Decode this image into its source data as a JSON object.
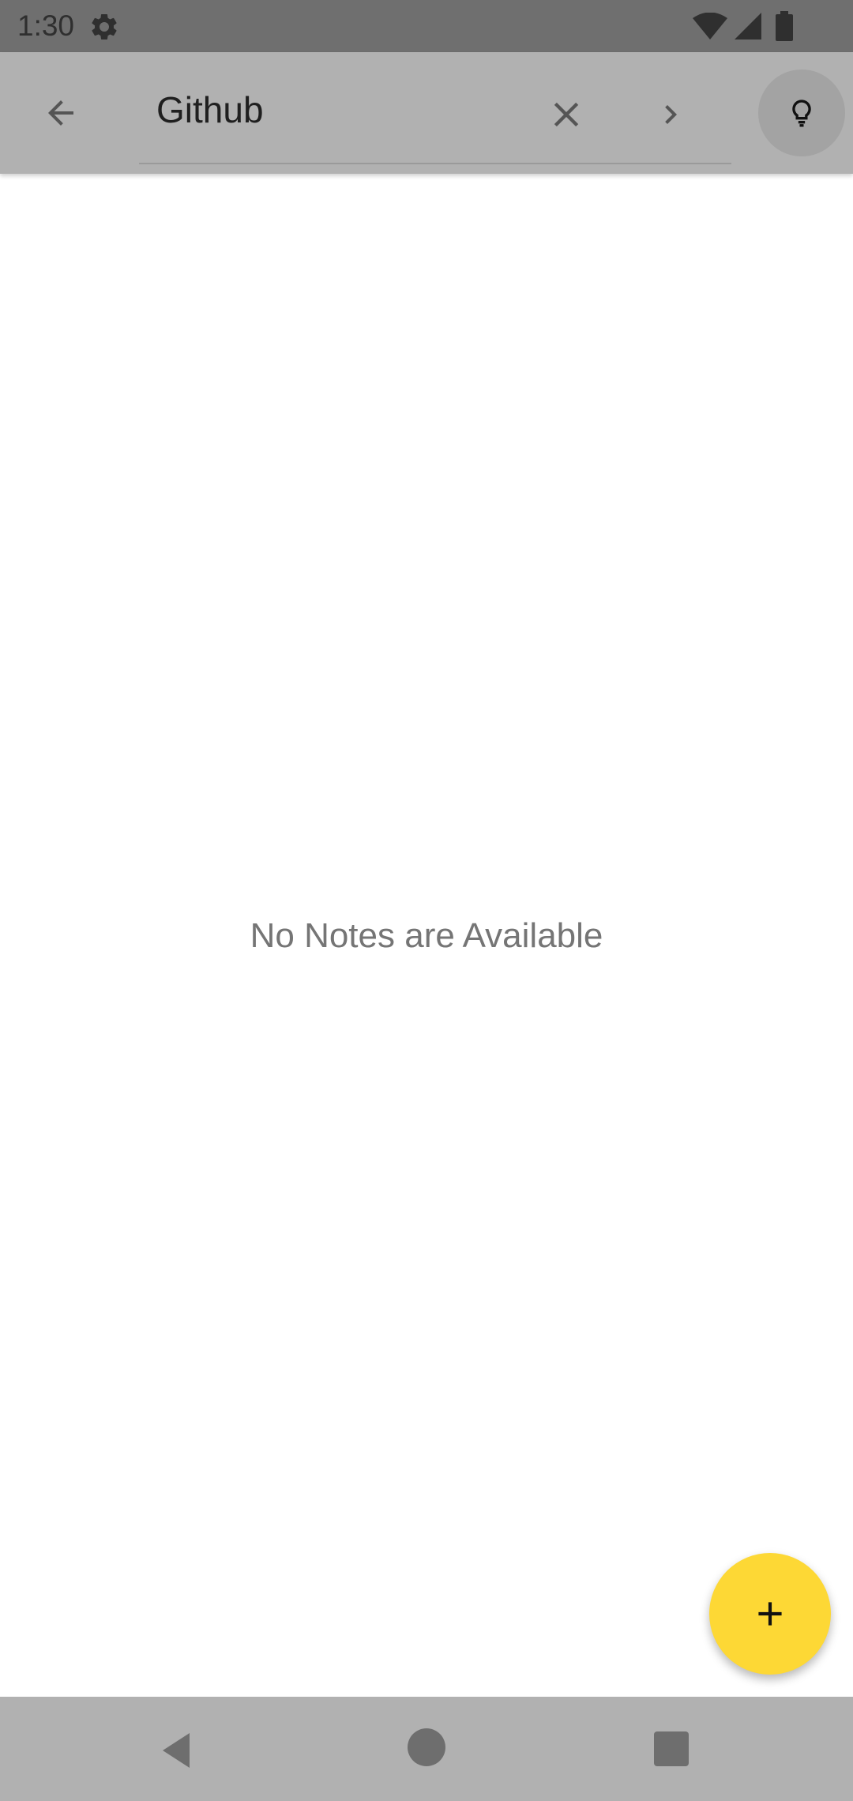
{
  "status_bar": {
    "time": "1:30",
    "icons": [
      "gear-icon",
      "wifi-icon",
      "cellular-signal-icon",
      "battery-icon"
    ]
  },
  "toolbar": {
    "search_value": "Github",
    "back_icon": "arrow-left-icon",
    "clear_icon": "close-icon",
    "next_icon": "chevron-right-icon",
    "bulb_icon": "lightbulb-icon"
  },
  "main": {
    "empty_message": "No Notes are Available"
  },
  "fab": {
    "icon": "plus-icon",
    "color": "#fdd835"
  },
  "nav_bar": {
    "icons": [
      "back-triangle-icon",
      "home-circle-icon",
      "recents-square-icon"
    ]
  }
}
